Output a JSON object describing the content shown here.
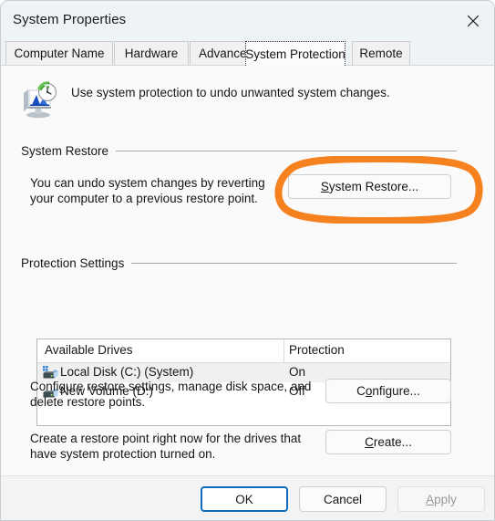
{
  "window": {
    "title": "System Properties",
    "close_icon": "close-icon"
  },
  "tabs": [
    {
      "label": "Computer Name",
      "selected": false
    },
    {
      "label": "Hardware",
      "selected": false
    },
    {
      "label": "Advanced",
      "selected": false
    },
    {
      "label": "System Protection",
      "selected": true
    },
    {
      "label": "Remote",
      "selected": false
    }
  ],
  "header": {
    "icon": "system-restore-icon",
    "description": "Use system protection to undo unwanted system changes."
  },
  "system_restore": {
    "group_label": "System Restore",
    "description_line1": "You can undo system changes by reverting",
    "description_line2": "your computer to a previous restore point.",
    "button_accel": "S",
    "button_rest": "ystem Restore..."
  },
  "protection_settings": {
    "group_label": "Protection Settings",
    "columns": [
      "Available Drives",
      "Protection"
    ],
    "rows": [
      {
        "icon": "system-drive-icon",
        "name": "Local Disk (C:) (System)",
        "protection": "On",
        "selected": true
      },
      {
        "icon": "drive-icon",
        "name": "New Volume (D:)",
        "protection": "Off",
        "selected": false
      }
    ],
    "configure": {
      "description_line1": "Configure restore settings, manage disk space, and",
      "description_line2": "delete restore points.",
      "button_pre": "C",
      "button_accel": "o",
      "button_rest": "nfigure..."
    },
    "create": {
      "description_line1": "Create a restore point right now for the drives that",
      "description_line2": "have system protection turned on.",
      "button_accel": "C",
      "button_rest": "reate..."
    }
  },
  "footer": {
    "ok_label": "OK",
    "cancel_label": "Cancel",
    "apply_accel": "A",
    "apply_rest": "pply",
    "apply_disabled": true
  },
  "annotation": {
    "shape": "ellipse-highlight",
    "color": "#f5811f",
    "target": "system-restore-button"
  },
  "colors": {
    "titlebar": "#eef3f5",
    "content": "#fafafa",
    "footer": "#f3f3f3",
    "accent": "#0f6cbd",
    "annotation_orange": "#f5811f"
  }
}
